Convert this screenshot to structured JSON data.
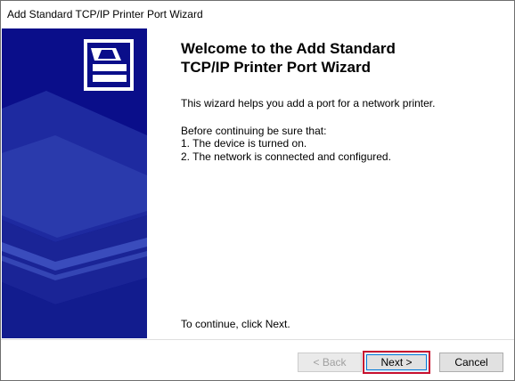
{
  "window": {
    "title": "Add Standard TCP/IP Printer Port Wizard"
  },
  "side_panel": {
    "icon": "printer-port-wizard-icon",
    "color": "#0a0e8a"
  },
  "main": {
    "heading": "Welcome to the Add Standard\nTCP/IP Printer Port Wizard",
    "intro": "This wizard helps you add a port for a network printer.",
    "before_label": "Before continuing be sure that:",
    "requirements": [
      "1.  The device is turned on.",
      "2.  The network is connected and configured."
    ],
    "continue_text": "To continue, click Next."
  },
  "buttons": {
    "back": "< Back",
    "next": "Next >",
    "cancel": "Cancel",
    "highlight_color": "#c8102e"
  }
}
